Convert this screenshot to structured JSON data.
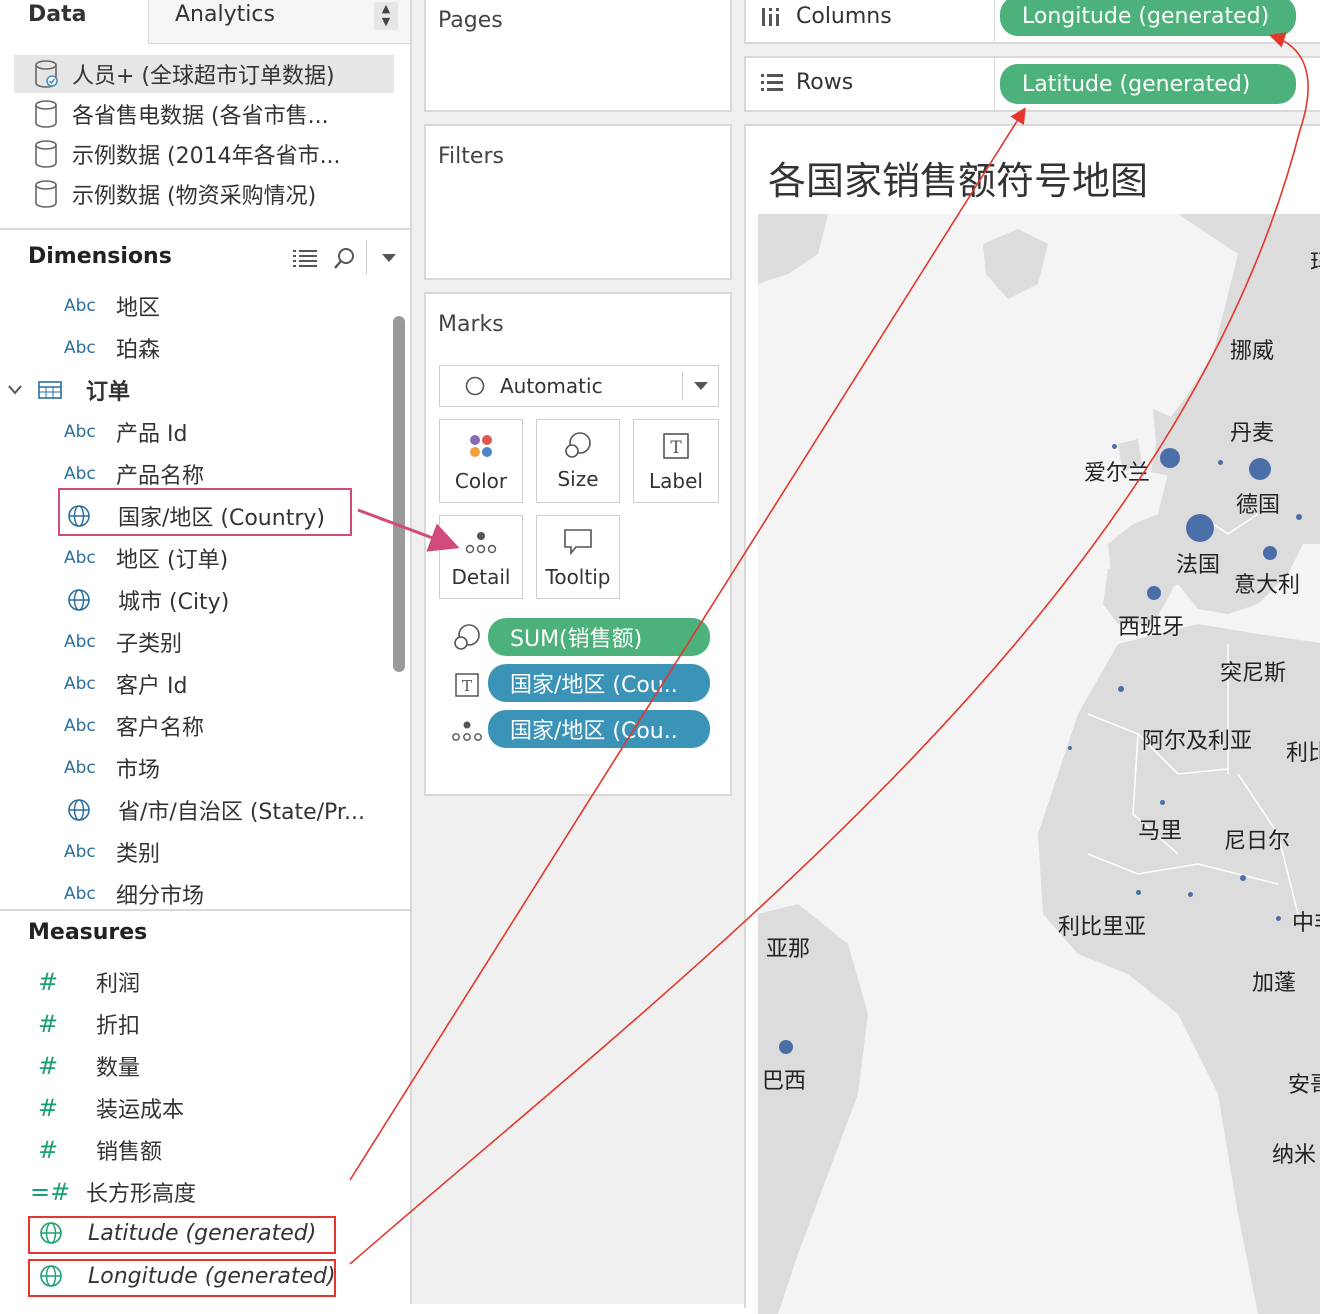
{
  "left_panel": {
    "tab_data": "Data",
    "tab_analytics": "Analytics",
    "datasources": [
      "人员+ (全球超市订单数据)",
      "各省售电数据 (各省市售...",
      "示例数据 (2014年各省市...",
      "示例数据 (物资采购情况)"
    ],
    "dimensions_title": "Dimensions",
    "dimensions": [
      {
        "type": "Abc",
        "label": "地区"
      },
      {
        "type": "Abc",
        "label": "珀森"
      },
      {
        "type": "table",
        "label": "订单"
      },
      {
        "type": "Abc",
        "label": "产品 Id"
      },
      {
        "type": "Abc",
        "label": "产品名称"
      },
      {
        "type": "globe",
        "label": "国家/地区 (Country)"
      },
      {
        "type": "Abc",
        "label": "地区 (订单)"
      },
      {
        "type": "globe",
        "label": "城市 (City)"
      },
      {
        "type": "Abc",
        "label": "子类别"
      },
      {
        "type": "Abc",
        "label": "客户 Id"
      },
      {
        "type": "Abc",
        "label": "客户名称"
      },
      {
        "type": "Abc",
        "label": "市场"
      },
      {
        "type": "globe",
        "label": "省/市/自治区 (State/Pr..."
      },
      {
        "type": "Abc",
        "label": "类别"
      },
      {
        "type": "Abc",
        "label": "细分市场"
      }
    ],
    "measures_title": "Measures",
    "measures": [
      {
        "type": "hash",
        "label": "利润"
      },
      {
        "type": "hash",
        "label": "折扣"
      },
      {
        "type": "hash",
        "label": "数量"
      },
      {
        "type": "hash",
        "label": "装运成本"
      },
      {
        "type": "hash",
        "label": "销售额"
      },
      {
        "type": "calc",
        "label": "长方形高度"
      },
      {
        "type": "globe",
        "label": "Latitude (generated)"
      },
      {
        "type": "globe",
        "label": "Longitude (generated)"
      }
    ]
  },
  "middle": {
    "pages": "Pages",
    "filters": "Filters",
    "marks": "Marks",
    "mark_type": "Automatic",
    "buttons": [
      "Color",
      "Size",
      "Label",
      "Detail",
      "Tooltip"
    ],
    "pills": [
      "SUM(销售额)",
      "国家/地区 (Cou..",
      "国家/地区 (Cou.."
    ]
  },
  "shelves": {
    "columns_label": "Columns",
    "columns_pill": "Longitude (generated)",
    "rows_label": "Rows",
    "rows_pill": "Latitude (generated)"
  },
  "map": {
    "title": "各国家销售额符号地图",
    "labels": [
      "挪威",
      "丹麦",
      "爱尔兰",
      "德国",
      "法国",
      "意大利",
      "西班牙",
      "突尼斯",
      "阿尔及利亚",
      "利比",
      "马里",
      "尼日尔",
      "利比里亚",
      "中非",
      "加蓬",
      "巴西",
      "安哥",
      "纳米",
      "亚那",
      "玛"
    ]
  },
  "colors": {
    "green_pill": "#4cb17a",
    "blue_pill": "#3b93b8",
    "highlight_pink": "#d14a7c",
    "annotation_red": "#e5362b",
    "map_dot": "#4a6fa8"
  }
}
